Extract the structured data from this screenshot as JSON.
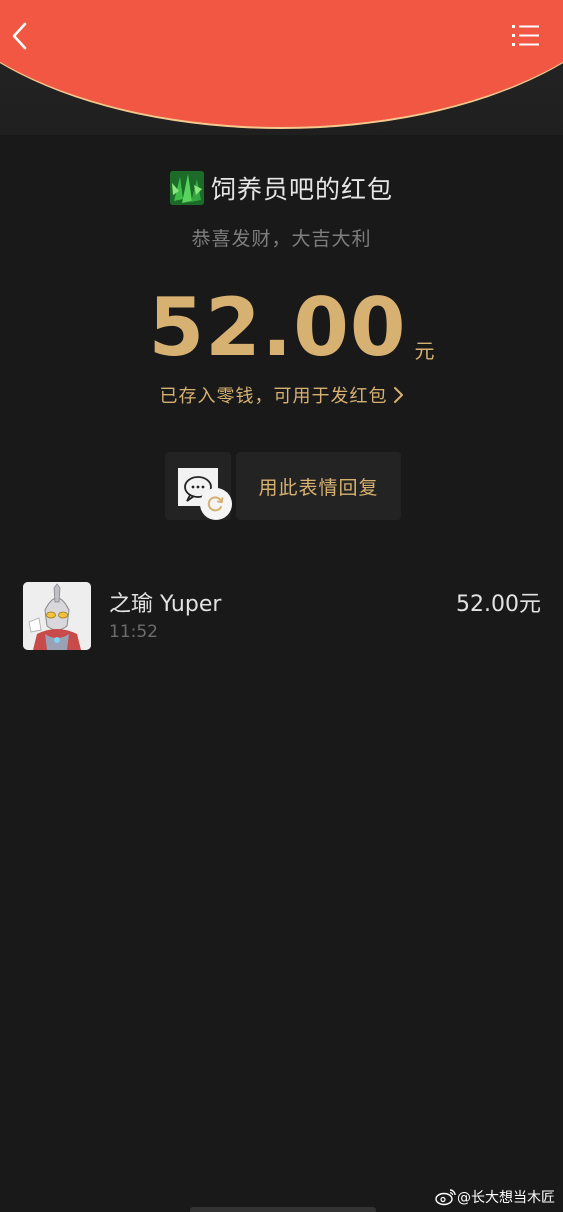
{
  "header": {
    "back_icon": "chevron-left-icon",
    "menu_icon": "list-menu-icon",
    "accent_color": "#f25744",
    "rim_color": "#f3c98d"
  },
  "sender": {
    "title": "饲养员吧的红包",
    "blessing": "恭喜发财，大吉大利",
    "avatar_icon": "green-leaf-avatar"
  },
  "amount": {
    "value": "52.00",
    "unit": "元",
    "saved_text": "已存入零钱，可用于发红包",
    "color": "#d6b171"
  },
  "sticker_reply": {
    "label": "用此表情回复",
    "refresh_icon": "refresh-icon"
  },
  "receivers": [
    {
      "name": "之瑜 Yuper",
      "time": "11:52",
      "amount": "52.00元"
    }
  ],
  "watermark": {
    "text": "@长大想当木匠",
    "icon": "weibo-icon"
  }
}
